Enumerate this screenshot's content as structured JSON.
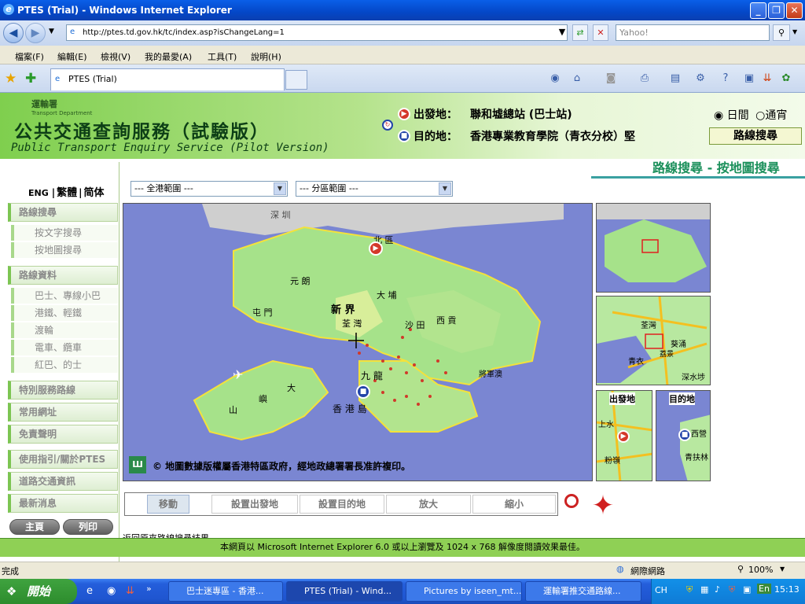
{
  "window": {
    "title": "PTES (Trial) - Windows Internet Explorer"
  },
  "address": {
    "url": "http://ptes.td.gov.hk/tc/index.asp?isChangeLang=1",
    "search_placeholder": "Yahoo!"
  },
  "menu": [
    "檔案(F)",
    "編輯(E)",
    "檢視(V)",
    "我的最愛(A)",
    "工具(T)",
    "說明(H)"
  ],
  "tab": {
    "label": "PTES (Trial)"
  },
  "header": {
    "dept_cn": "運輸署",
    "dept_en": "Transport Department",
    "title_cn": "公共交通查詢服務（試驗版）",
    "title_en": "Public Transport Enquiry Service (Pilot Version)",
    "origin_label": "出發地：",
    "origin_value": "聯和墟總站 (巴士站)",
    "dest_label": "目的地：",
    "dest_value": "香港專業教育學院（青衣分校）堅",
    "radio_day": "日間",
    "radio_night": "通宵",
    "route_search_button": "路線搜尋"
  },
  "sidebar": {
    "lang_en": "ENG",
    "lang_tc": "繁體",
    "lang_sc": "简体",
    "route_search": "路線搜尋",
    "by_text": "按文字搜尋",
    "by_map": "按地圖搜尋",
    "route_info": "路線資料",
    "bus_minibus": "巴士、專線小巴",
    "rail_lightrail": "港鐵、輕鐵",
    "ferry": "渡輪",
    "tram_peak": "電車、纜車",
    "redbus_taxi": "紅巴、的士",
    "special_routes": "特別服務路線",
    "common_links": "常用網址",
    "disclaimer": "免責聲明",
    "guide_about": "使用指引/關於PTES",
    "road_traffic": "道路交通資訊",
    "latest_news": "最新消息",
    "home_button": "主頁",
    "print_button": "列印"
  },
  "main": {
    "page_title": "路線搜尋 - 按地圖搜尋",
    "territory_select": "--- 全港範圍 ---",
    "district_select": "--- 分區範圍 ---",
    "map_labels": {
      "shenzhen": "深 圳",
      "north": "北 區",
      "yuenlong": "元 朗",
      "newterritories": "新 界",
      "taipo": "大 埔",
      "tuenmun": "屯 門",
      "tsuenwan": "荃 灣",
      "shatin": "沙 田",
      "saikung": "西 貢",
      "kowloon": "九 龍",
      "tko": "將軍澳",
      "lantau_tai": "大",
      "lantau_yu": "嶼",
      "lantau_shan": "山",
      "hkisland": "香 港 島"
    },
    "copyright": "© 地圖數據版權屬香港特區政府，經地政總署署長准許複印。",
    "minimap2_labels": {
      "tsuenwan": "荃灣",
      "kwaichung": "葵涌",
      "tsingyi": "青衣",
      "laichikok": "荔景",
      "ssp": "深水埗"
    },
    "origin_panel": {
      "title": "出發地",
      "label1": "上水",
      "label2": "粉嶺"
    },
    "dest_panel": {
      "title": "目的地",
      "label1": "西營",
      "label2": "青扶林"
    },
    "tools": [
      "移動",
      "設置出發地",
      "設置目的地",
      "放大",
      "縮小"
    ],
    "back_link": "返回原來路線搜尋結果",
    "footer": "本網頁以 Microsoft Internet Explorer 6.0 或以上瀏覽及 1024 x 768 解像度閱讀效果最佳。"
  },
  "statusbar": {
    "status": "完成",
    "zone": "網際網路",
    "zoom": "100%"
  },
  "taskbar": {
    "start": "開始",
    "tasks": [
      "巴士迷專區 - 香港...",
      "PTES (Trial) - Wind...",
      "Pictures by iseen_mt...",
      "運輸署推交通路線..."
    ],
    "tray_lang": "CH",
    "time": "15:13"
  },
  "colors": {
    "accent_green": "#7cc552",
    "title_green": "#1a8f5a",
    "origin_red": "#d4382a",
    "dest_blue": "#2244a8"
  }
}
